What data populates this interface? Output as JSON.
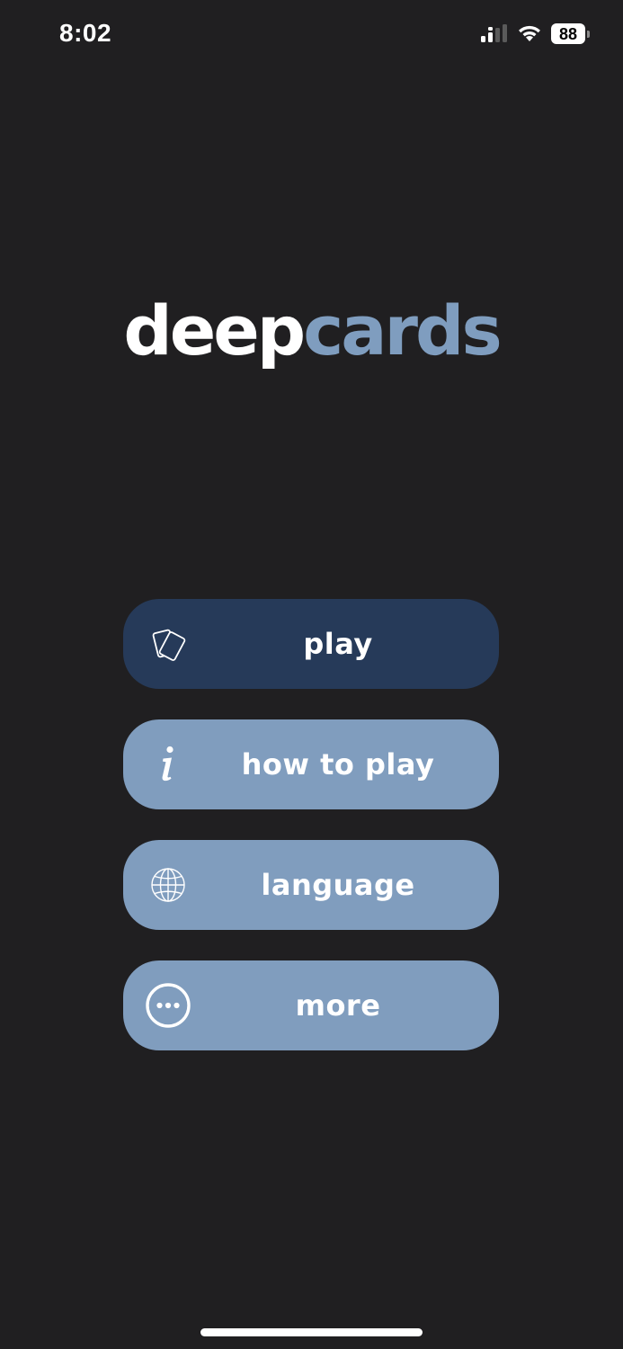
{
  "status_bar": {
    "time": "8:02",
    "battery_level": "88"
  },
  "logo": {
    "part1": "deep",
    "part2": "cards"
  },
  "menu": {
    "play_label": "play",
    "how_to_play_label": "how to play",
    "language_label": "language",
    "more_label": "more"
  },
  "colors": {
    "background": "#201f21",
    "primary_button": "#263a59",
    "secondary_button": "#809dbe",
    "logo_accent": "#7f9dbf"
  },
  "icons": {
    "play": "cards-icon",
    "how_to_play": "info-icon",
    "language": "globe-icon",
    "more": "more-icon"
  }
}
